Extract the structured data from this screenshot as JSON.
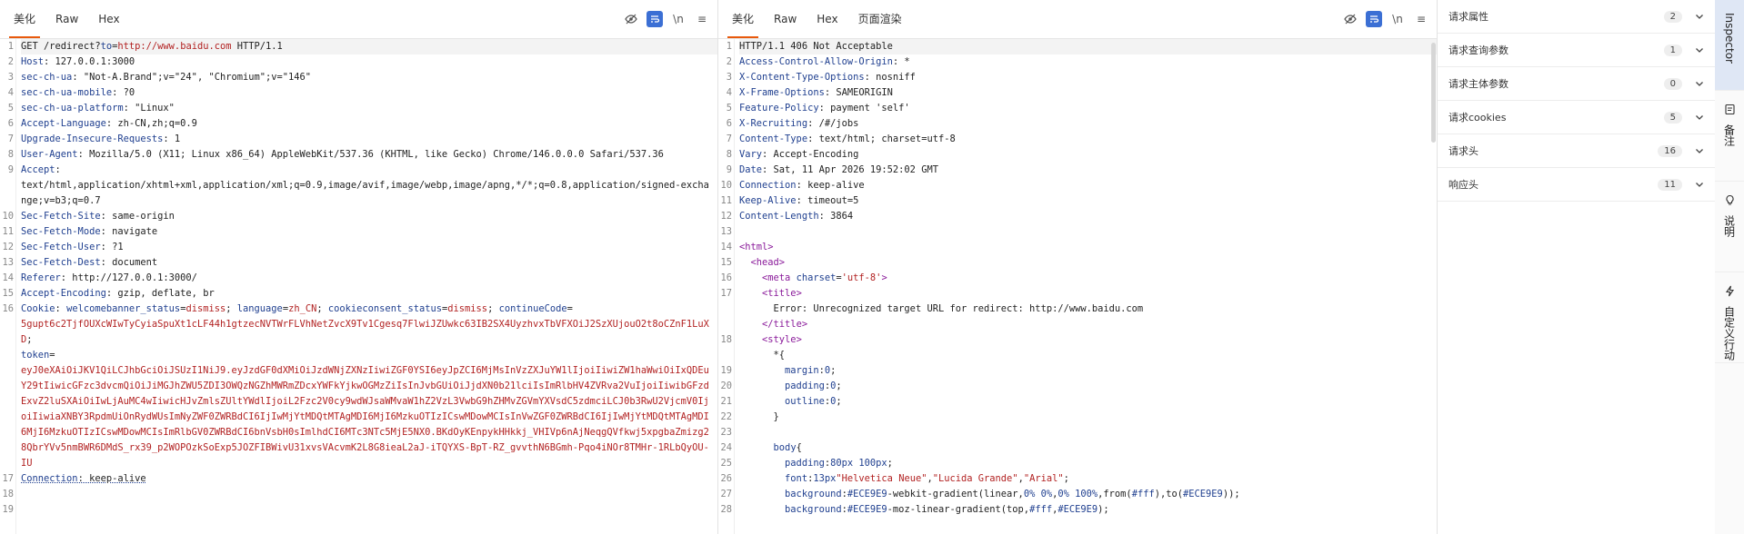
{
  "request": {
    "tabs": [
      "美化",
      "Raw",
      "Hex"
    ],
    "lines": [
      {
        "n": "1",
        "segs": [
          [
            "v",
            "GET /redirect?"
          ],
          [
            "k",
            "to"
          ],
          [
            "v",
            "="
          ],
          [
            "red",
            "http://www.baidu.com"
          ],
          [
            "v",
            " HTTP/1.1"
          ]
        ]
      },
      {
        "n": "2",
        "segs": [
          [
            "k",
            "Host"
          ],
          [
            "v",
            ": 127.0.0.1:3000"
          ]
        ]
      },
      {
        "n": "3",
        "segs": [
          [
            "k",
            "sec-ch-ua"
          ],
          [
            "v",
            ": \"Not-A.Brand\";v=\"24\", \"Chromium\";v=\"146\""
          ]
        ]
      },
      {
        "n": "4",
        "segs": [
          [
            "k",
            "sec-ch-ua-mobile"
          ],
          [
            "v",
            ": ?0"
          ]
        ]
      },
      {
        "n": "5",
        "segs": [
          [
            "k",
            "sec-ch-ua-platform"
          ],
          [
            "v",
            ": \"Linux\""
          ]
        ]
      },
      {
        "n": "6",
        "segs": [
          [
            "k",
            "Accept-Language"
          ],
          [
            "v",
            ": zh-CN,zh;q=0.9"
          ]
        ]
      },
      {
        "n": "7",
        "segs": [
          [
            "k",
            "Upgrade-Insecure-Requests"
          ],
          [
            "v",
            ": 1"
          ]
        ]
      },
      {
        "n": "8",
        "segs": [
          [
            "k",
            "User-Agent"
          ],
          [
            "v",
            ": Mozilla/5.0 (X11; Linux x86_64) AppleWebKit/537.36 (KHTML, like Gecko) Chrome/146.0.0.0 Safari/537.36"
          ]
        ]
      },
      {
        "n": "9",
        "segs": [
          [
            "k",
            "Accept"
          ],
          [
            "v",
            ":\ntext/html,application/xhtml+xml,application/xml;q=0.9,image/avif,image/webp,image/apng,*/*;q=0.8,application/signed-exchange;v=b3;q=0.7"
          ]
        ]
      },
      {
        "n": "10",
        "segs": [
          [
            "k",
            "Sec-Fetch-Site"
          ],
          [
            "v",
            ": same-origin"
          ]
        ]
      },
      {
        "n": "11",
        "segs": [
          [
            "k",
            "Sec-Fetch-Mode"
          ],
          [
            "v",
            ": navigate"
          ]
        ]
      },
      {
        "n": "12",
        "segs": [
          [
            "k",
            "Sec-Fetch-User"
          ],
          [
            "v",
            ": ?1"
          ]
        ]
      },
      {
        "n": "13",
        "segs": [
          [
            "k",
            "Sec-Fetch-Dest"
          ],
          [
            "v",
            ": document"
          ]
        ]
      },
      {
        "n": "14",
        "segs": [
          [
            "k",
            "Referer"
          ],
          [
            "v",
            ": http://127.0.0.1:3000/"
          ]
        ]
      },
      {
        "n": "15",
        "segs": [
          [
            "k",
            "Accept-Encoding"
          ],
          [
            "v",
            ": gzip, deflate, br"
          ]
        ]
      },
      {
        "n": "16",
        "segs": [
          [
            "k",
            "Cookie"
          ],
          [
            "v",
            ": "
          ],
          [
            "k",
            "welcomebanner_status"
          ],
          [
            "v",
            "="
          ],
          [
            "red",
            "dismiss"
          ],
          [
            "v",
            "; "
          ],
          [
            "k",
            "language"
          ],
          [
            "v",
            "="
          ],
          [
            "red",
            "zh_CN"
          ],
          [
            "v",
            "; "
          ],
          [
            "k",
            "cookieconsent_status"
          ],
          [
            "v",
            "="
          ],
          [
            "red",
            "dismiss"
          ],
          [
            "v",
            "; "
          ],
          [
            "k",
            "continueCode"
          ],
          [
            "v",
            "=\n"
          ],
          [
            "red",
            "5gupt6c2TjfOUXcWIwTyCyiaSpuXt1cLF44h1gtzecNVTWrFLVhNetZvcX9Tv1Cgesq7FlwiJZUwkc63IB2SX4UyzhvxTbVFXOiJ2SzXUjouO2t8oCZnF1LuXD"
          ],
          [
            "v",
            ";\n"
          ],
          [
            "k",
            "token"
          ],
          [
            "v",
            "=\n"
          ],
          [
            "red",
            "eyJ0eXAiOiJKV1QiLCJhbGciOiJSUzI1NiJ9.eyJzdGF0dXMiOiJzdWNjZXNzIiwiZGF0YSI6eyJpZCI6MjMsInVzZXJuYW1lIjoiIiwiZW1haWwiOiIxQDEuY29tIiwicGFzc3dvcmQiOiJiMGJhZWU5ZDI3OWQzNGZhMWRmZDcxYWFkYjkwOGMzZiIsInJvbGUiOiJjdXN0b21lciIsImRlbHV4ZVRva2VuIjoiIiwibGFzdExvZ2luSXAiOiIwLjAuMC4wIiwicHJvZmlsZUltYWdlIjoiL2Fzc2V0cy9wdWJsaWMvaW1hZ2VzL3VwbG9hZHMvZGVmYXVsdC5zdmciLCJ0b3RwU2VjcmV0IjoiIiwiaXNBY3RpdmUiOnRydWUsImNyZWF0ZWRBdCI6IjIwMjYtMDQtMTAgMDI6MjI6MzkuOTIzICswMDowMCIsInVwZGF0ZWRBdCI6IjIwMjYtMDQtMTAgMDI6MjI6MzkuOTIzICswMDowMCIsImRlbGV0ZWRBdCI6bnVsbH0sImlhdCI6MTc3NTc5MjE5NX0.BKdOyKEnpykHHkkj_VHIVp6nAjNeqgQVfkwj5xpgbaZmizg28QbrYVv5nmBWR6DMdS_rx39_p2WOPOzkSoExp5JOZFIBWivU31xvsVAcvmK2L8G8ieaL2aJ-iTQYXS-BpT-RZ_gvvthN6BGmh-Pqo4iNOr8TMHr-1RLbQyOU-IU"
          ]
        ]
      },
      {
        "n": "17",
        "segs": [
          [
            "k ul",
            "Connection"
          ],
          [
            "v ul",
            ": keep-alive"
          ]
        ]
      },
      {
        "n": "18",
        "segs": [
          [
            "v",
            ""
          ]
        ]
      },
      {
        "n": "19",
        "segs": [
          [
            "v",
            ""
          ]
        ]
      }
    ]
  },
  "response": {
    "tabs": [
      "美化",
      "Raw",
      "Hex",
      "页面渲染"
    ],
    "lines": [
      {
        "n": "1",
        "segs": [
          [
            "v",
            "HTTP/1.1 406 Not Acceptable"
          ]
        ]
      },
      {
        "n": "2",
        "segs": [
          [
            "k",
            "Access-Control-Allow-Origin"
          ],
          [
            "v",
            ": *"
          ]
        ]
      },
      {
        "n": "3",
        "segs": [
          [
            "k",
            "X-Content-Type-Options"
          ],
          [
            "v",
            ": nosniff"
          ]
        ]
      },
      {
        "n": "4",
        "segs": [
          [
            "k",
            "X-Frame-Options"
          ],
          [
            "v",
            ": SAMEORIGIN"
          ]
        ]
      },
      {
        "n": "5",
        "segs": [
          [
            "k",
            "Feature-Policy"
          ],
          [
            "v",
            ": payment 'self'"
          ]
        ]
      },
      {
        "n": "6",
        "segs": [
          [
            "k",
            "X-Recruiting"
          ],
          [
            "v",
            ": /#/jobs"
          ]
        ]
      },
      {
        "n": "7",
        "segs": [
          [
            "k",
            "Content-Type"
          ],
          [
            "v",
            ": text/html; charset=utf-8"
          ]
        ]
      },
      {
        "n": "8",
        "segs": [
          [
            "k",
            "Vary"
          ],
          [
            "v",
            ": Accept-Encoding"
          ]
        ]
      },
      {
        "n": "9",
        "segs": [
          [
            "k",
            "Date"
          ],
          [
            "v",
            ": Sat, 11 Apr 2026 19:52:02 GMT"
          ]
        ]
      },
      {
        "n": "10",
        "segs": [
          [
            "k",
            "Connection"
          ],
          [
            "v",
            ": keep-alive"
          ]
        ]
      },
      {
        "n": "11",
        "segs": [
          [
            "k",
            "Keep-Alive"
          ],
          [
            "v",
            ": timeout=5"
          ]
        ]
      },
      {
        "n": "12",
        "segs": [
          [
            "k",
            "Content-Length"
          ],
          [
            "v",
            ": 3864"
          ]
        ]
      },
      {
        "n": "13",
        "segs": [
          [
            "v",
            ""
          ]
        ]
      },
      {
        "n": "14",
        "segs": [
          [
            "tag",
            "<html>"
          ]
        ]
      },
      {
        "n": "15",
        "segs": [
          [
            "v",
            "  "
          ],
          [
            "tag",
            "<head>"
          ]
        ]
      },
      {
        "n": "16",
        "segs": [
          [
            "v",
            "    "
          ],
          [
            "tag",
            "<meta "
          ],
          [
            "attr",
            "charset"
          ],
          [
            "v",
            "="
          ],
          [
            "red",
            "'utf-8'"
          ],
          [
            "tag",
            ">"
          ]
        ]
      },
      {
        "n": "",
        "segs": [
          [
            "v",
            ""
          ]
        ]
      },
      {
        "n": "17",
        "segs": [
          [
            "v",
            "    "
          ],
          [
            "tag",
            "<title>"
          ]
        ]
      },
      {
        "n": "",
        "segs": [
          [
            "v",
            "      Error: Unrecognized target URL for redirect: http://www.baidu.com"
          ]
        ]
      },
      {
        "n": "",
        "segs": [
          [
            "v",
            "    "
          ],
          [
            "tag",
            "</title>"
          ]
        ]
      },
      {
        "n": "18",
        "segs": [
          [
            "v",
            "    "
          ],
          [
            "tag",
            "<style>"
          ]
        ]
      },
      {
        "n": "",
        "segs": [
          [
            "v",
            "      *{"
          ]
        ]
      },
      {
        "n": "19",
        "segs": [
          [
            "v",
            "        "
          ],
          [
            "attr",
            "margin"
          ],
          [
            "v",
            ":"
          ],
          [
            "num",
            "0"
          ],
          [
            "v",
            ";"
          ]
        ]
      },
      {
        "n": "20",
        "segs": [
          [
            "v",
            "        "
          ],
          [
            "attr",
            "padding"
          ],
          [
            "v",
            ":"
          ],
          [
            "num",
            "0"
          ],
          [
            "v",
            ";"
          ]
        ]
      },
      {
        "n": "21",
        "segs": [
          [
            "v",
            "        "
          ],
          [
            "attr",
            "outline"
          ],
          [
            "v",
            ":"
          ],
          [
            "num",
            "0"
          ],
          [
            "v",
            ";"
          ]
        ]
      },
      {
        "n": "22",
        "segs": [
          [
            "v",
            "      }"
          ]
        ]
      },
      {
        "n": "23",
        "segs": [
          [
            "v",
            ""
          ]
        ]
      },
      {
        "n": "24",
        "segs": [
          [
            "v",
            "      "
          ],
          [
            "attr",
            "body"
          ],
          [
            "v",
            "{"
          ]
        ]
      },
      {
        "n": "25",
        "segs": [
          [
            "v",
            "        "
          ],
          [
            "attr",
            "padding"
          ],
          [
            "v",
            ":"
          ],
          [
            "num",
            "80px 100px"
          ],
          [
            "v",
            ";"
          ]
        ]
      },
      {
        "n": "26",
        "segs": [
          [
            "v",
            "        "
          ],
          [
            "attr",
            "font"
          ],
          [
            "v",
            ":"
          ],
          [
            "num",
            "13px"
          ],
          [
            "red",
            "\"Helvetica Neue\""
          ],
          [
            "v",
            ","
          ],
          [
            "red",
            "\"Lucida Grande\""
          ],
          [
            "v",
            ","
          ],
          [
            "red",
            "\"Arial\""
          ],
          [
            "v",
            ";"
          ]
        ]
      },
      {
        "n": "27",
        "segs": [
          [
            "v",
            "        "
          ],
          [
            "attr",
            "background"
          ],
          [
            "v",
            ":"
          ],
          [
            "num",
            "#ECE9E9"
          ],
          [
            "v",
            "-webkit-gradient(linear,"
          ],
          [
            "num",
            "0% 0%"
          ],
          [
            "v",
            ","
          ],
          [
            "num",
            "0% 100%"
          ],
          [
            "v",
            ",from("
          ],
          [
            "num",
            "#fff"
          ],
          [
            "v",
            "),to("
          ],
          [
            "num",
            "#ECE9E9"
          ],
          [
            "v",
            "));"
          ]
        ]
      },
      {
        "n": "28",
        "segs": [
          [
            "v",
            "        "
          ],
          [
            "attr",
            "background"
          ],
          [
            "v",
            ":"
          ],
          [
            "num",
            "#ECE9E9"
          ],
          [
            "v",
            "-moz-linear-gradient(top,"
          ],
          [
            "num",
            "#fff"
          ],
          [
            "v",
            ","
          ],
          [
            "num",
            "#ECE9E9"
          ],
          [
            "v",
            ");"
          ]
        ]
      }
    ]
  },
  "inspector": {
    "rows": [
      {
        "label": "请求属性",
        "count": "2"
      },
      {
        "label": "请求查询参数",
        "count": "1"
      },
      {
        "label": "请求主体参数",
        "count": "0"
      },
      {
        "label": "请求cookies",
        "count": "5"
      },
      {
        "label": "请求头",
        "count": "16"
      },
      {
        "label": "响应头",
        "count": "11"
      }
    ]
  },
  "side_tabs": [
    {
      "label": "Inspector",
      "icon": "inspector-icon"
    },
    {
      "label": "备注",
      "icon": "note-icon"
    },
    {
      "label": "说明",
      "icon": "lightbulb-icon"
    },
    {
      "label": "自定义行动",
      "icon": "lightning-icon"
    }
  ],
  "colors": {
    "accent": "#e8590c",
    "active_tool": "#3b6fd4",
    "side_active": "#dfe7f5"
  }
}
